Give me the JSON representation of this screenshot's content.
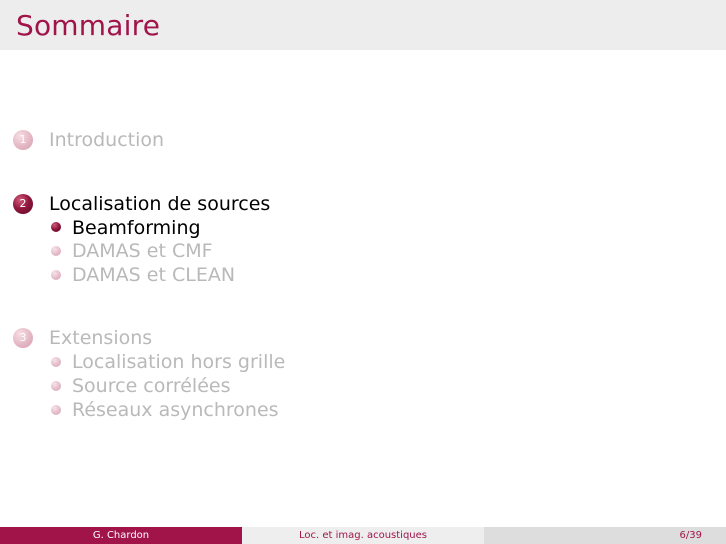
{
  "frame": {
    "title": "Sommaire"
  },
  "toc": [
    {
      "number": "1",
      "title": "Introduction",
      "state": "faded",
      "subsections": []
    },
    {
      "number": "2",
      "title": "Localisation de sources",
      "state": "active",
      "subsections": [
        {
          "title": "Beamforming",
          "state": "active"
        },
        {
          "title": "DAMAS et CMF",
          "state": "faded"
        },
        {
          "title": "DAMAS et CLEAN",
          "state": "faded"
        }
      ]
    },
    {
      "number": "3",
      "title": "Extensions",
      "state": "faded",
      "subsections": [
        {
          "title": "Localisation hors grille",
          "state": "faded"
        },
        {
          "title": "Source corrélées",
          "state": "faded"
        },
        {
          "title": "Réseaux asynchrones",
          "state": "faded"
        }
      ]
    }
  ],
  "footer": {
    "author": "G. Chardon",
    "short_title": "Loc. et imag. acoustiques",
    "page": "6/39"
  },
  "colors": {
    "accent": "#a0144a",
    "faded_text": "#b9b9b9",
    "title_bar": "#ededed"
  }
}
